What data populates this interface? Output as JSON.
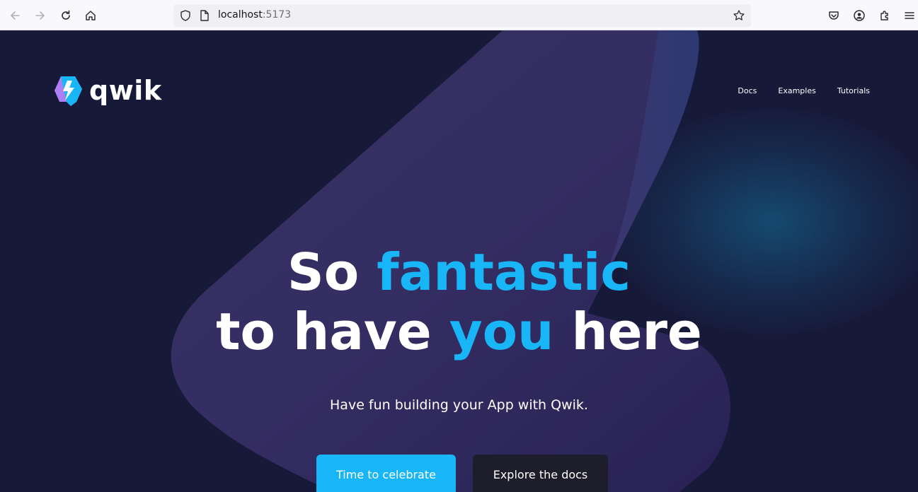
{
  "browser": {
    "url_host": "localhost",
    "url_port": ":5173",
    "icons": [
      "back-arrow-icon",
      "forward-arrow-icon",
      "reload-icon",
      "home-icon",
      "shield-icon",
      "page-icon",
      "bookmark-star-icon",
      "pocket-icon",
      "account-icon",
      "extensions-icon",
      "menu-icon"
    ]
  },
  "site": {
    "logo_text": "qwik",
    "nav": [
      {
        "label": "Docs"
      },
      {
        "label": "Examples"
      },
      {
        "label": "Tutorials"
      }
    ]
  },
  "hero": {
    "line1_a": "So ",
    "line1_b": "fantastic",
    "line2_a": "to have ",
    "line2_b": "you",
    "line2_c": " here",
    "subtitle": "Have fun building your App with Qwik.",
    "primary_button": "Time to celebrate",
    "secondary_button": "Explore the docs"
  },
  "colors": {
    "background": "#171938",
    "accent": "#18b6f6",
    "secondary_button": "#1d1d2c"
  }
}
